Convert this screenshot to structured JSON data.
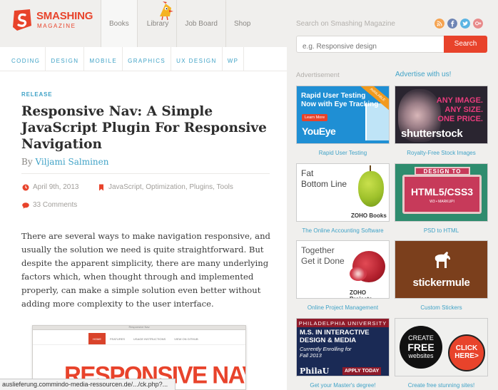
{
  "brand": {
    "name": "SMASHING",
    "sub": "MAGAZINE",
    "color": "#e8432b"
  },
  "nav": {
    "main": [
      "Books",
      "Library",
      "Job Board",
      "Shop"
    ],
    "sub": [
      "CODING",
      "DESIGN",
      "MOBILE",
      "GRAPHICS",
      "UX DESIGN",
      "WP"
    ]
  },
  "article": {
    "category": "RELEASE",
    "title": "Responsive Nav: A Simple JavaScript Plugin For Responsive Navigation",
    "by": "By",
    "author": "Viljami Salminen",
    "date": "April 9th, 2013",
    "tags": "JavaScript, Optimization, Plugins, Tools",
    "comments": "33 Comments",
    "body": "There are several ways to make navigation responsive, and usually the solution we need is quite straightforward. But despite the apparent simplicity, there are many underlying factors which, when thought through and implemented properly, can make a simple solution even better without adding more complexity to the user interface.",
    "screenshot": {
      "window_title": "Responsive Nav",
      "nav": [
        "HOME",
        "FEATURES",
        "USAGE INSTRUCTIONS",
        "VIEW ON GITHUB"
      ],
      "headline": "RESPONSIVE NAV"
    }
  },
  "search": {
    "label": "Search on Smashing Magazine",
    "placeholder": "e.g. Responsive design",
    "button": "Search"
  },
  "social": [
    {
      "icon": "rss-icon",
      "color": "#f5a350"
    },
    {
      "icon": "facebook-icon",
      "color": "#6d84b4"
    },
    {
      "icon": "twitter-icon",
      "color": "#5ab4e3"
    },
    {
      "icon": "google-plus-icon",
      "color": "#e88a8a"
    }
  ],
  "ads": {
    "label": "Advertisement",
    "advertise_link": "Advertise with us!",
    "items": [
      {
        "caption": "Rapid User Testing",
        "lines": [
          "Rapid User Testing",
          "Now with Eye Tracking"
        ],
        "button": "Learn More",
        "brand": "YouEye",
        "badge": "AVAILABLE"
      },
      {
        "caption": "Royalty-Free Stock Images",
        "lines": [
          "ANY IMAGE.",
          "ANY SIZE.",
          "ONE PRICE."
        ],
        "brand": "shutterstock"
      },
      {
        "caption": "The Online Accounting Software",
        "lines": [
          "Fat",
          "Bottom Line"
        ],
        "brand": "ZOHO Books"
      },
      {
        "caption": "PSD to HTML",
        "lines": [
          "DESIGN TO",
          "HTML5/CSS3",
          "W3 • MARKUPI"
        ]
      },
      {
        "caption": "Online Project Management",
        "lines": [
          "Together",
          "Get it Done"
        ],
        "brand": "ZOHO Projects"
      },
      {
        "caption": "Custom Stickers",
        "brand": "stickermule"
      },
      {
        "caption": "Get your Master's degree!",
        "lines": [
          "PHILADELPHIA UNIVERSITY",
          "M.S. IN INTERACTIVE",
          "DESIGN & MEDIA",
          "Currently Enrolling for",
          "Fall 2013"
        ],
        "brand": "PhilaU",
        "button": "APPLY TODAY"
      },
      {
        "caption": "Create free stunning sites!",
        "lines": [
          "CREATE",
          "FREE",
          "websites",
          "CLICK",
          "HERE>"
        ]
      }
    ]
  },
  "status_bar": "auslieferung.commindo-media-ressourcen.de/.../ck.php?..."
}
